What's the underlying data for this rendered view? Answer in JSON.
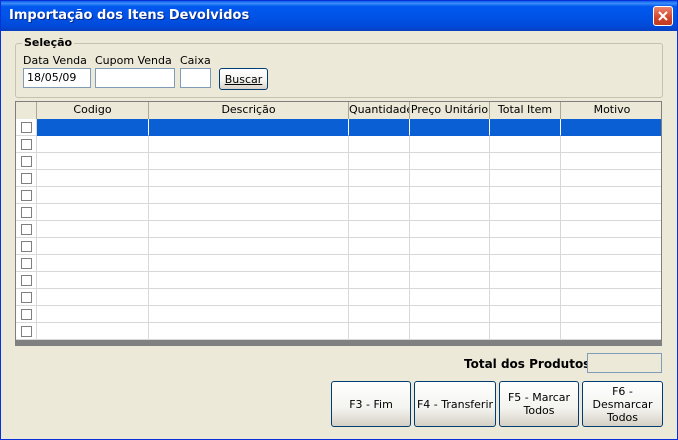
{
  "window": {
    "title": "Importação dos Itens Devolvidos"
  },
  "selection": {
    "legend": "Seleção",
    "date_label": "Data Venda",
    "date_value": "18/05/09",
    "coupon_label": "Cupom Venda",
    "coupon_value": "",
    "register_label": "Caixa",
    "register_value": "",
    "search_button": "Buscar"
  },
  "grid": {
    "columns": [
      "Codigo",
      "Descrição",
      "Quantidade",
      "Preço Unitário",
      "Total Item",
      "Motivo"
    ],
    "row_count": 13,
    "selected_row": 0
  },
  "totals": {
    "label": "Total dos Produtos",
    "value": ""
  },
  "actions": {
    "f3": "F3 - Fim",
    "f4": "F4 - Transferir",
    "f5_line1": "F5 - Marcar",
    "f5_line2": "Todos",
    "f6_line1": "F6 - Desmarcar",
    "f6_line2": "Todos"
  },
  "colors": {
    "titlebar": "#0054e3",
    "selection": "#0a5fd4",
    "window_bg": "#ece9d8"
  }
}
